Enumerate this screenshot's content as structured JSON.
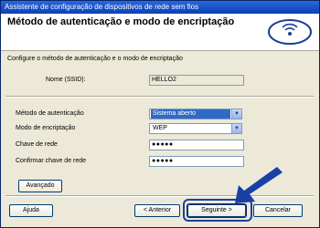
{
  "window": {
    "title": "Assistente de configuração de dispositivos de rede sem fios"
  },
  "header": {
    "title": "Método de autenticação e modo de encriptação"
  },
  "subtitle": "Configure o método de autenticação e o modo de encriptação",
  "ssid": {
    "label": "Nome (SSID):",
    "value": "HELLO2"
  },
  "auth": {
    "label": "Método de autenticação",
    "value": "Sistema aberto"
  },
  "encryption": {
    "label": "Modo de encriptação",
    "value": "WEP"
  },
  "network_key": {
    "label": "Chave de rede",
    "value": "●●●●●"
  },
  "confirm_key": {
    "label": "Confirmar chave de rede",
    "value": "●●●●●"
  },
  "buttons": {
    "advanced": "Avançado",
    "help": "Ajuda",
    "back": "< Anterior",
    "next": "Seguinte >",
    "cancel": "Cancelar"
  },
  "colors": {
    "accent": "#1a3fa5",
    "selection": "#316ac5"
  },
  "icons": {
    "logo": "wireless-logo-icon",
    "pointer": "blue-arrow-icon"
  }
}
